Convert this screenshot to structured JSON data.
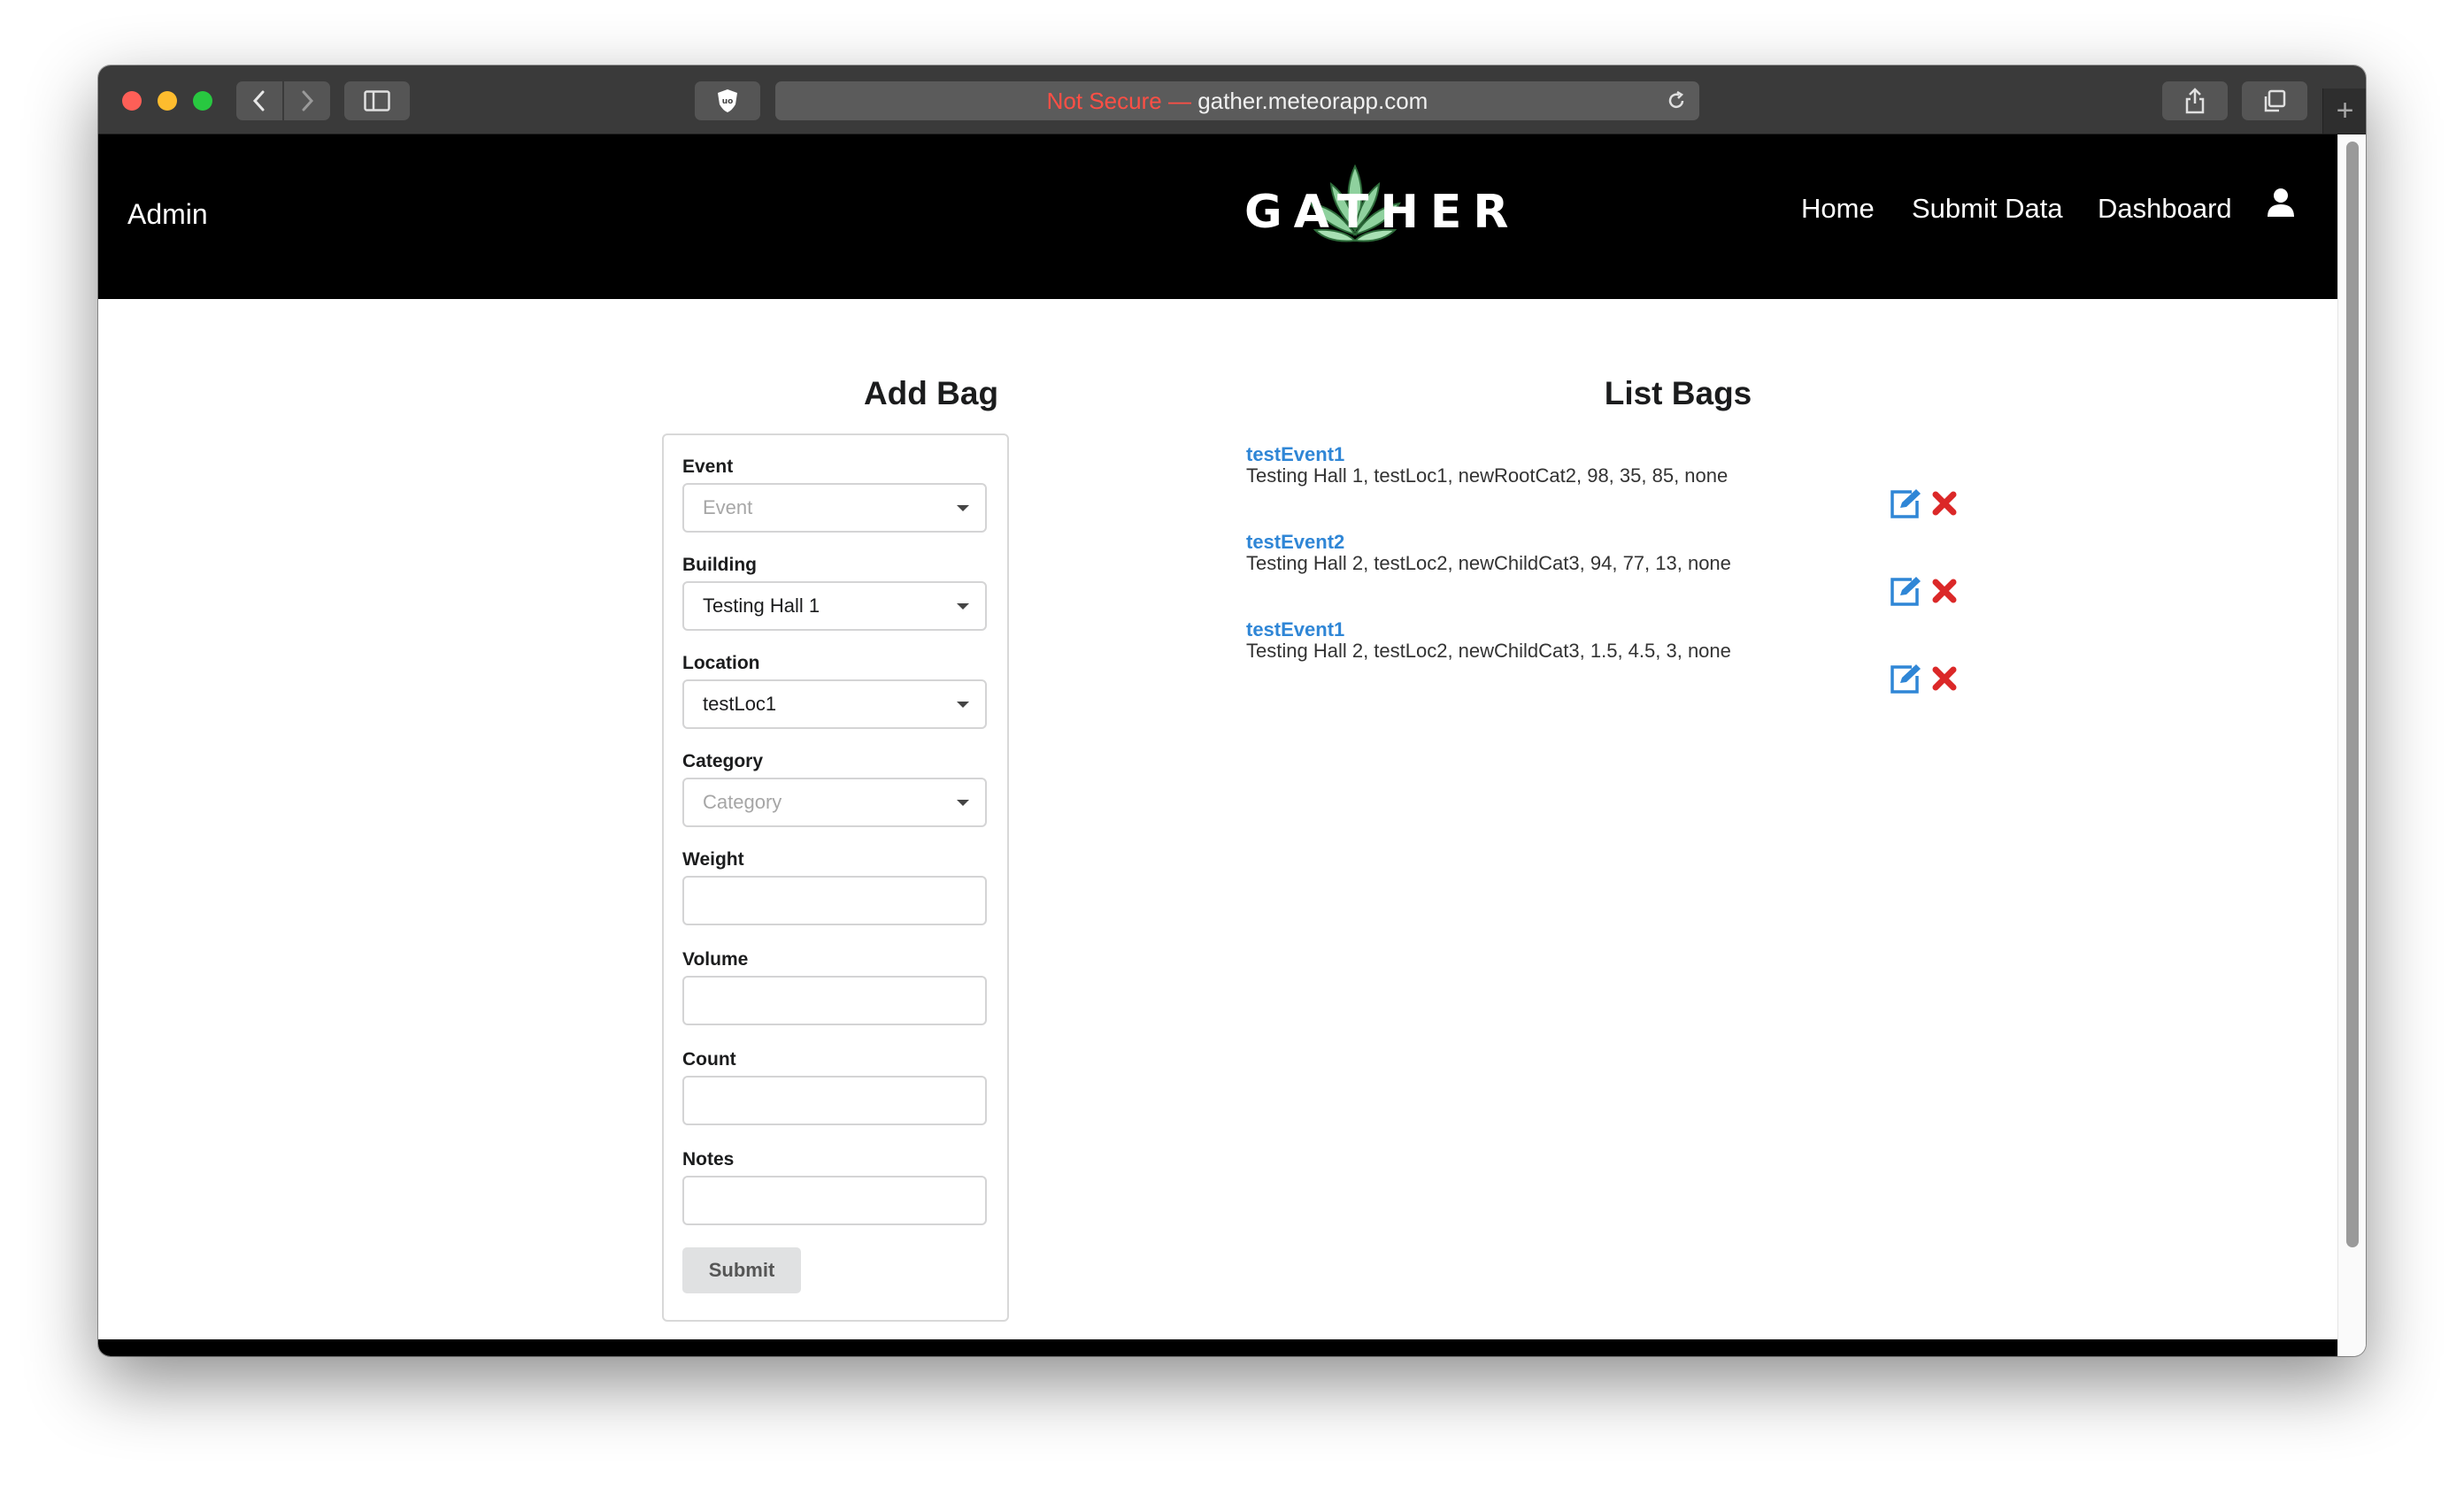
{
  "browser": {
    "url_insecure_label": "Not Secure —",
    "url_host": "gather.meteorapp.com"
  },
  "nav": {
    "brand": "Admin",
    "logo_text": "GATHER",
    "links": [
      "Home",
      "Submit Data",
      "Dashboard"
    ]
  },
  "add_bag": {
    "title": "Add Bag",
    "fields": {
      "event": {
        "label": "Event",
        "placeholder": "Event",
        "value": ""
      },
      "building": {
        "label": "Building",
        "value": "Testing Hall 1"
      },
      "location": {
        "label": "Location",
        "value": "testLoc1"
      },
      "category": {
        "label": "Category",
        "placeholder": "Category",
        "value": ""
      },
      "weight": {
        "label": "Weight",
        "value": ""
      },
      "volume": {
        "label": "Volume",
        "value": ""
      },
      "count": {
        "label": "Count",
        "value": ""
      },
      "notes": {
        "label": "Notes",
        "value": ""
      }
    },
    "submit_label": "Submit"
  },
  "list_bags": {
    "title": "List Bags",
    "items": [
      {
        "event": "testEvent1",
        "details": "Testing Hall 1, testLoc1, newRootCat2, 98, 35, 85, none"
      },
      {
        "event": "testEvent2",
        "details": "Testing Hall 2, testLoc2, newChildCat3, 94, 77, 13, none"
      },
      {
        "event": "testEvent1",
        "details": "Testing Hall 2, testLoc2, newChildCat3, 1.5, 4.5, 3, none"
      }
    ]
  },
  "colors": {
    "accent": "#2f86d6",
    "delete": "#db2828",
    "nav_bg": "#000000"
  }
}
